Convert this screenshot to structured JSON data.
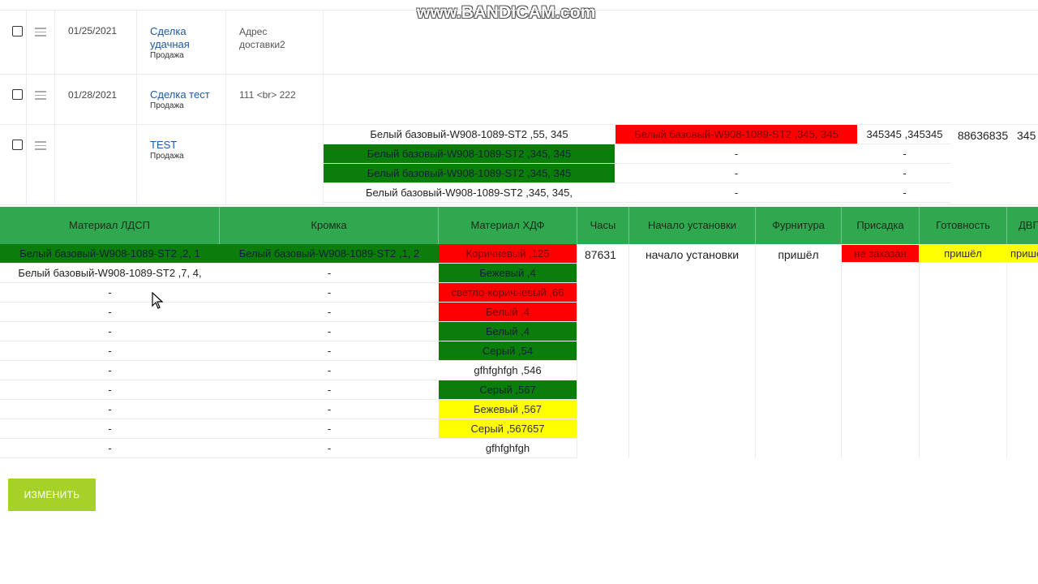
{
  "watermark": "www.BANDICAM.com",
  "deals": [
    {
      "date": "01/25/2021",
      "name": "Сделка удачная",
      "type": "Продажа",
      "address": "Адрес доставки2"
    },
    {
      "date": "01/28/2021",
      "name": "Сделка тест",
      "type": "Продажа",
      "address": "111 <br> 222"
    },
    {
      "date": "",
      "name": "TEST",
      "type": "Продажа",
      "address": ""
    }
  ],
  "test_details": {
    "col_a": [
      "Белый базовый-W908-1089-ST2 ,55, 345",
      "Белый базовый-W908-1089-ST2 ,345, 345",
      "Белый базовый-W908-1089-ST2 ,345, 345",
      "Белый базовый-W908-1089-ST2 ,345, 345,"
    ],
    "col_b": [
      "Белый базовый-W908-1089-ST2 ,345, 345",
      "-",
      "-",
      "-"
    ],
    "col_c": [
      "345345 ,345345",
      "-",
      "-",
      "-"
    ],
    "col_d": "88636835",
    "col_e": "345"
  },
  "headers": [
    "Материал ЛДСП",
    "Кромка",
    "Материал ХДФ",
    "Часы",
    "Начало установки",
    "Фурнитура",
    "Присадка",
    "Готовность",
    "ДВП"
  ],
  "ldsp": [
    "Белый базовый-W908-1089-ST2 ,2, 1",
    "Белый базовый-W908-1089-ST2 ,7, 4,",
    "-",
    "-",
    "-",
    "-",
    "-",
    "-",
    "-",
    "-",
    "-"
  ],
  "kromka": [
    "Белый базовый-W908-1089-ST2 ,1, 2",
    "-",
    "-",
    "-",
    "-",
    "-",
    "-",
    "-",
    "-",
    "-",
    "-"
  ],
  "hdf": [
    "Коричневый ,125",
    "Бежевый ,4",
    "светло-коричневый ,66",
    "Белый ,4",
    "Белый ,4",
    "Серый ,54",
    "gfhfghfgh ,546",
    "Серый ,567",
    "Бежевый ,567",
    "Серый ,567657",
    "gfhfghfgh"
  ],
  "hdf_colors": [
    "red",
    "green",
    "red",
    "red",
    "green",
    "green",
    "white",
    "green",
    "yellow",
    "yellow",
    "white"
  ],
  "first_row": {
    "hours": "87631",
    "start": "начало установки",
    "furniture": "пришёл",
    "prisadka": "не заказан",
    "readiness": "пришёл",
    "dvp": "пришёл"
  },
  "colors": {
    "header_green": "#2fa84f",
    "cell_green": "#0a7d0a",
    "cell_red": "#ff0000",
    "cell_yellow": "#ffff00",
    "button": "#a6d228"
  },
  "button_label": "ИЗМЕНИТЬ"
}
